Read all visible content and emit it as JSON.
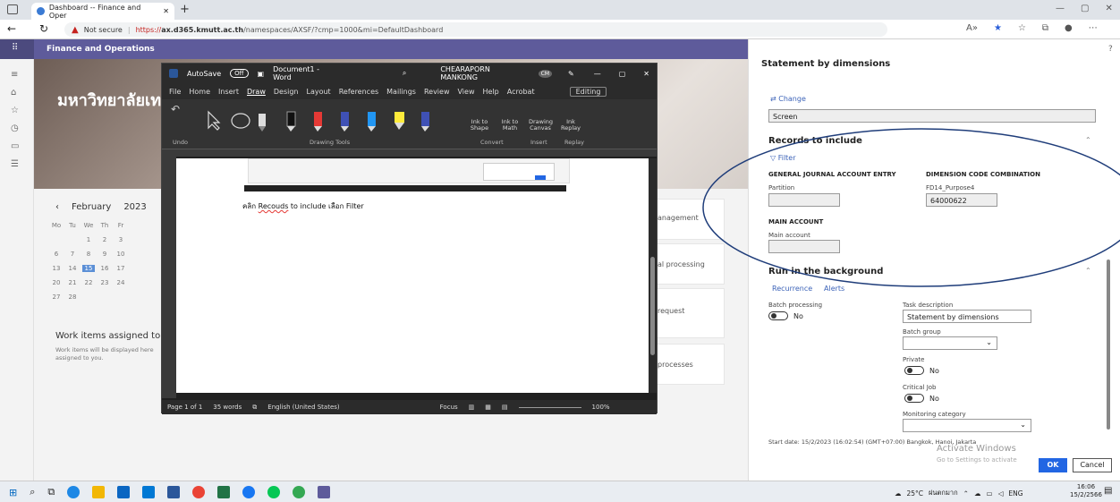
{
  "browser": {
    "tab_title": "Dashboard -- Finance and Oper",
    "not_secure": "Not secure",
    "url_https": "https://",
    "url_domain": "ax.d365.kmutt.ac.th",
    "url_path": "/namespaces/AXSF/?cmp=1000&mi=DefaultDashboard"
  },
  "app": {
    "title": "Finance and Operations",
    "hero_title": "มหาวิทยาลัยเท"
  },
  "calendar": {
    "month": "February",
    "year": "2023",
    "weekdays": [
      "Mo",
      "Tu",
      "We",
      "Th",
      "Fr"
    ],
    "weeks": [
      [
        "",
        "",
        "1",
        "2",
        "3"
      ],
      [
        "6",
        "7",
        "8",
        "9",
        "10"
      ],
      [
        "13",
        "14",
        "15",
        "16",
        "17"
      ],
      [
        "20",
        "21",
        "22",
        "23",
        "24"
      ],
      [
        "27",
        "28",
        "",
        "",
        ""
      ]
    ],
    "selected_day": "15"
  },
  "work_items": {
    "title": "Work items assigned to",
    "desc_line1": "Work items will be displayed here",
    "desc_line2": "assigned to you."
  },
  "tiles": [
    "anagement",
    "al processing",
    "request",
    "processes"
  ],
  "word": {
    "autosave": "AutoSave",
    "autosave_state": "Off",
    "doc_title": "Document1 - Word",
    "user": "CHEARAPORN MANKONG",
    "user_initials": "CM",
    "menu": [
      "File",
      "Home",
      "Insert",
      "Draw",
      "Design",
      "Layout",
      "References",
      "Mailings",
      "Review",
      "View",
      "Help",
      "Acrobat"
    ],
    "editing": "Editing",
    "ribbon_groups": [
      "Undo",
      "Drawing Tools",
      "Convert",
      "Insert",
      "Replay"
    ],
    "ribbon_buttons": [
      "Ink to Shape",
      "Ink to Math",
      "Drawing Canvas",
      "Ink Replay"
    ],
    "doc_text_prefix": "คลิก ",
    "doc_text_link": "Recouds",
    "doc_text_suffix": " to include เลือก Filter",
    "status_page": "Page 1 of 1",
    "status_words": "35 words",
    "status_lang": "English (United States)",
    "status_focus": "Focus",
    "status_zoom": "100%"
  },
  "panel": {
    "title": "Statement by dimensions",
    "help": "?",
    "change": "Change",
    "screen": "Screen",
    "records_title": "Records to include",
    "filter": "Filter",
    "gj_header": "GENERAL JOURNAL ACCOUNT ENTRY",
    "dcc_header": "DIMENSION CODE COMBINATION",
    "partition_label": "Partition",
    "partition_value": "",
    "fd14_label": "FD14_Purpose4",
    "fd14_value": "64000622",
    "main_account_header": "MAIN ACCOUNT",
    "main_account_label": "Main account",
    "main_account_value": "",
    "run_bg_title": "Run in the background",
    "recurrence": "Recurrence",
    "alerts": "Alerts",
    "batch_label": "Batch processing",
    "batch_value": "No",
    "task_desc_label": "Task description",
    "task_desc_value": "Statement by dimensions",
    "batch_group_label": "Batch group",
    "private_label": "Private",
    "private_value": "No",
    "critical_label": "Critical Job",
    "critical_value": "No",
    "monitoring_label": "Monitoring category",
    "start_date": "Start date: 15/2/2023 (16:02:54) (GMT+07:00) Bangkok, Hanoi, Jakarta",
    "watermark1": "Activate Windows",
    "watermark2": "Go to Settings to activate",
    "ok": "OK",
    "cancel": "Cancel"
  },
  "taskbar": {
    "weather": "25°C",
    "weather_text": "ฝนตกมาก",
    "lang": "ENG",
    "time": "16:06",
    "date": "15/2/2566"
  },
  "colors": {
    "accent": "#5e5b9b",
    "ellipse": "#1f3d7a",
    "ok_button": "#2266e3"
  }
}
